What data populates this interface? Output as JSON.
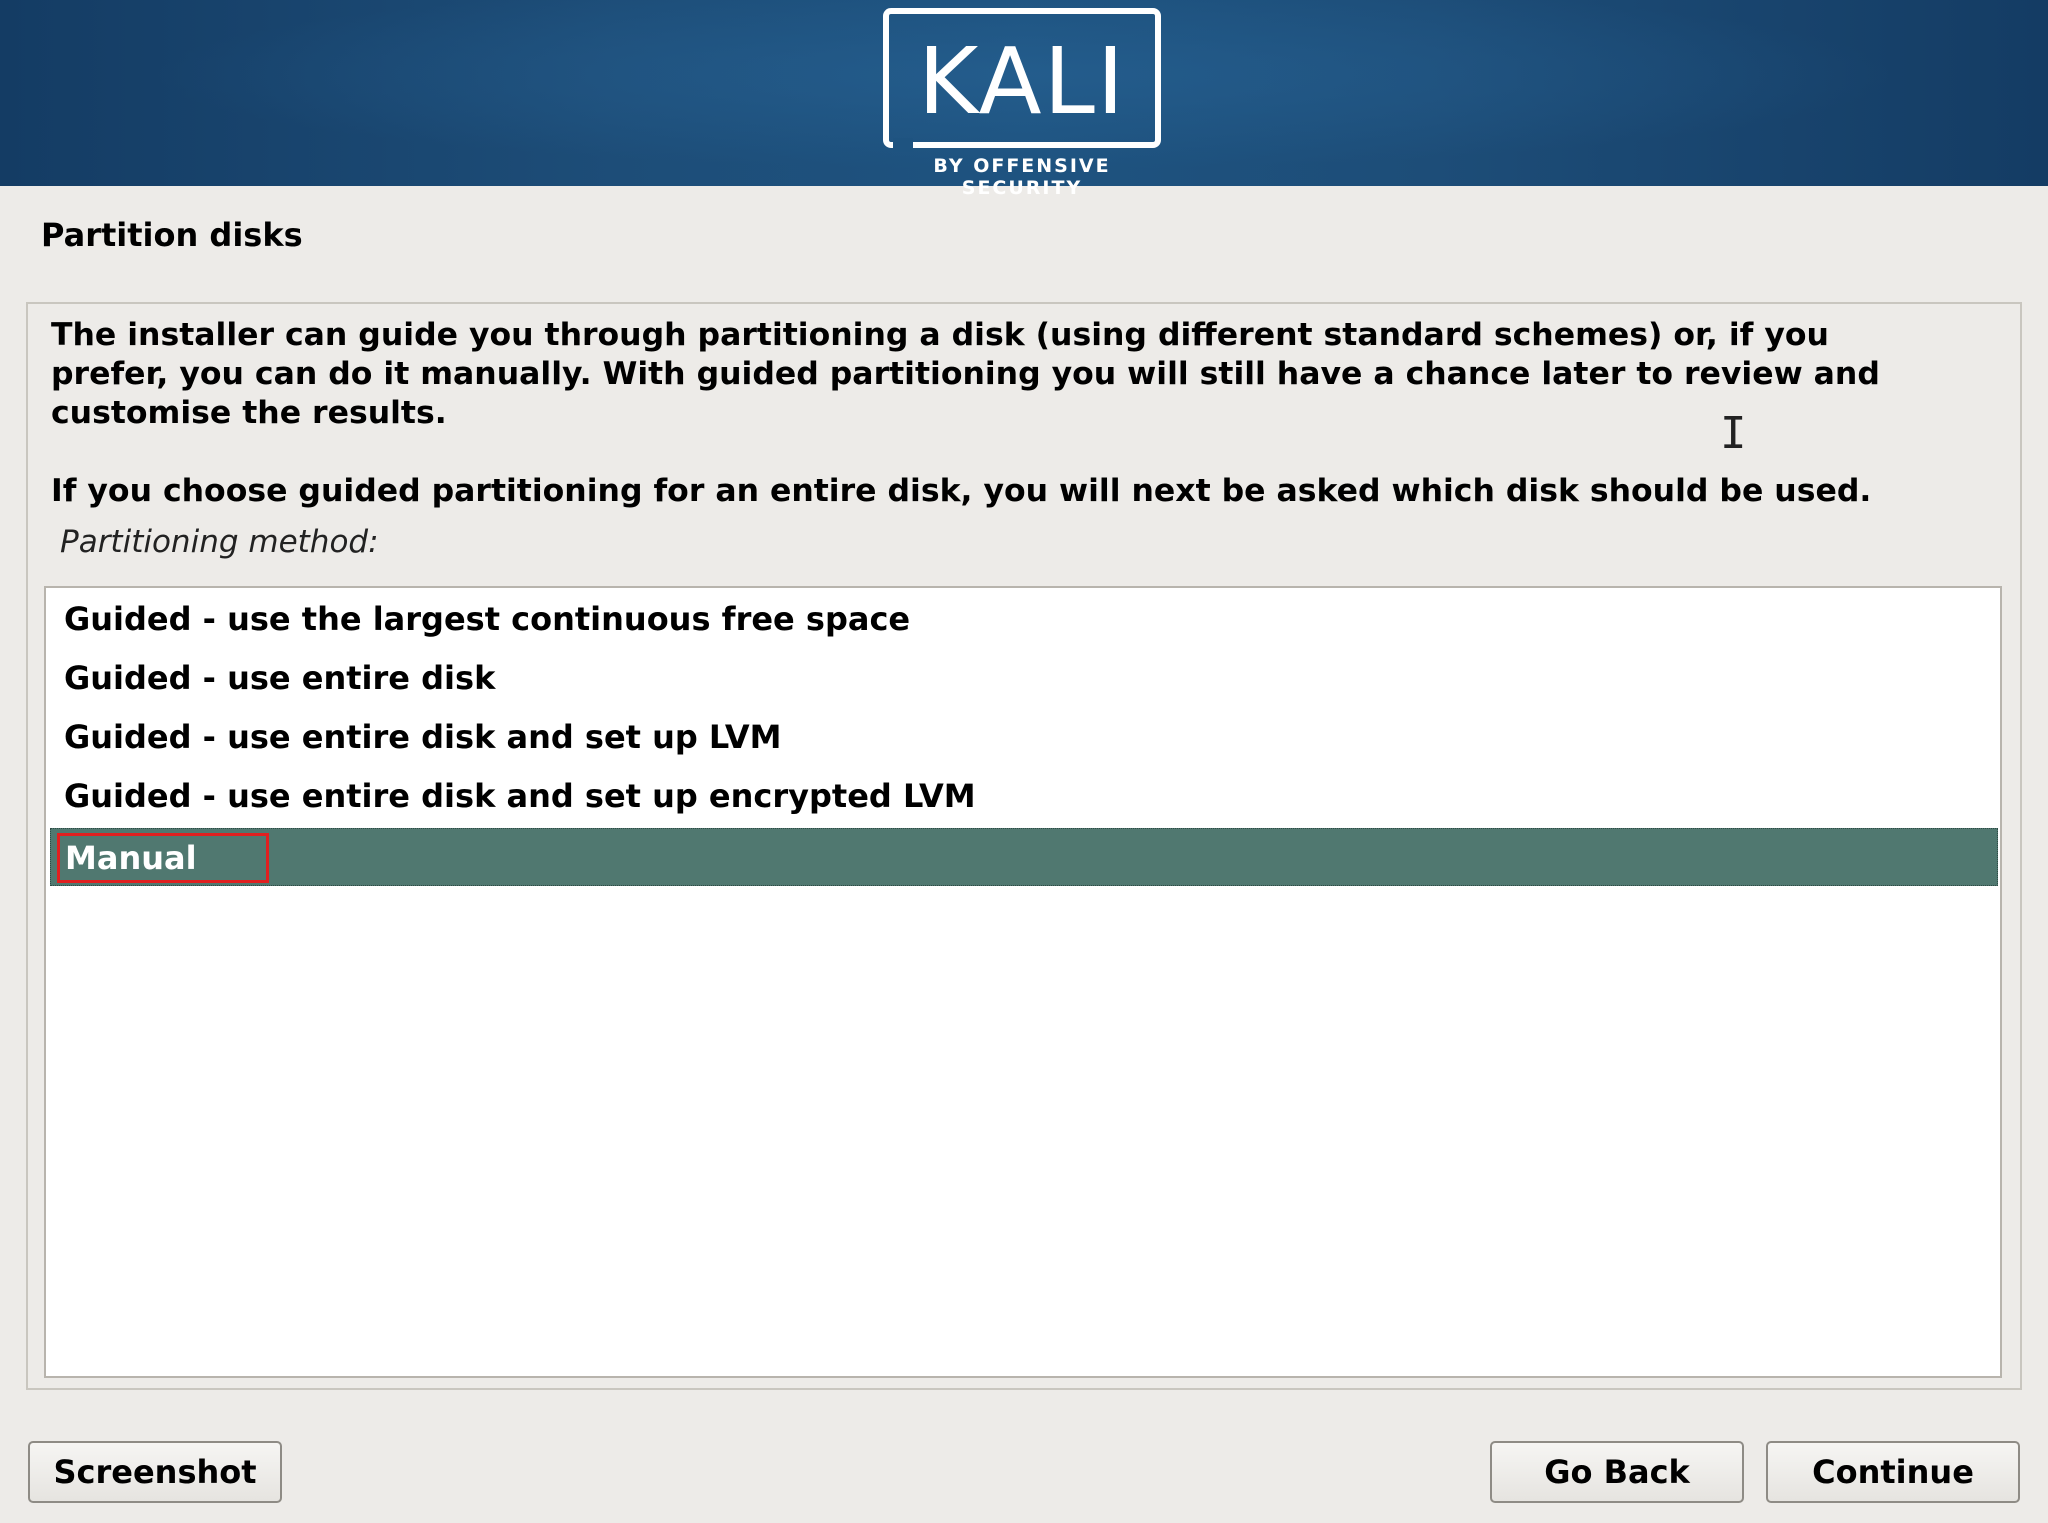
{
  "header": {
    "logo_text": "KALI",
    "logo_subtitle": "BY OFFENSIVE SECURITY"
  },
  "page": {
    "title": "Partition disks",
    "description": "The installer can guide you through partitioning a disk (using different standard schemes) or, if you\nprefer, you can do it manually. With guided partitioning you will still have a chance later to review and\ncustomise the results.",
    "description2": "If you choose guided partitioning for an entire disk, you will next be asked which disk should be used.",
    "method_label": "Partitioning method:"
  },
  "methods": [
    {
      "label": "Guided - use the largest continuous free space",
      "selected": false
    },
    {
      "label": "Guided - use entire disk",
      "selected": false
    },
    {
      "label": "Guided - use entire disk and set up LVM",
      "selected": false
    },
    {
      "label": "Guided - use entire disk and set up encrypted LVM",
      "selected": false
    },
    {
      "label": "Manual",
      "selected": true
    }
  ],
  "buttons": {
    "screenshot": "Screenshot",
    "go_back": "Go Back",
    "continue": "Continue"
  },
  "colors": {
    "banner": "#1e5380",
    "selection": "#507870",
    "highlight": "#e02020"
  }
}
